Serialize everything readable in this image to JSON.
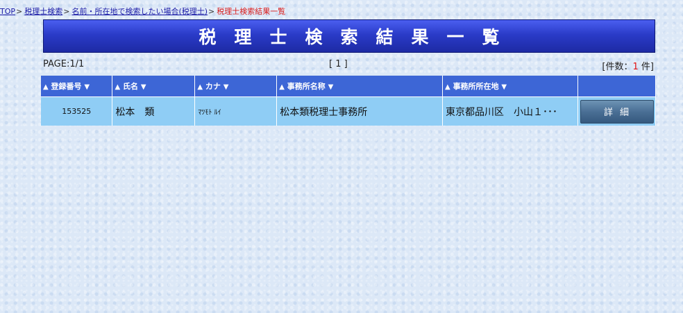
{
  "breadcrumb": {
    "top": "TOP",
    "sep1": ">",
    "search": "税理士検索",
    "sep2": ">",
    "name_search": "名前・所在地で検索したい場合(税理士)",
    "sep3": ">",
    "current": "税理士検索結果一覧"
  },
  "title": "税理士検索結果一覧",
  "pager": {
    "page_info": "PAGE:1/1",
    "links": "[ 1 ]",
    "count_prefix": "[件数：",
    "count": "1",
    "count_suffix": " 件]"
  },
  "table": {
    "headers": {
      "reg_no": "登録番号",
      "name": "氏名",
      "kana": "カナ",
      "office_name": "事務所名称",
      "office_address": "事務所所在地"
    },
    "sort_up": "▲",
    "sort_down": "▼",
    "rows": [
      {
        "reg_no": "153525",
        "name": "松本　類",
        "kana": "ﾏﾂﾓﾄ ﾙｲ",
        "office_name": "松本類税理士事務所",
        "office_address": "東京都品川区　小山１･･･",
        "detail_label": "詳細"
      }
    ]
  },
  "colors": {
    "title_bar": "#2a3bc8",
    "header_bg": "#3d66d6",
    "row_bg": "#8fcdf5",
    "count_highlight": "#e01010"
  }
}
